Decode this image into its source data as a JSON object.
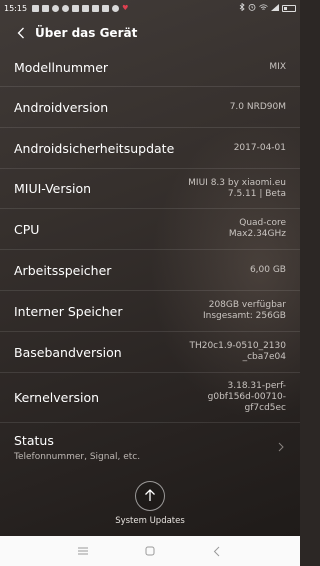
{
  "status_bar": {
    "time": "15:15",
    "battery_level": 0.25
  },
  "header": {
    "title": "Über das Gerät"
  },
  "rows": [
    {
      "label": "Modellnummer",
      "value": "MIX"
    },
    {
      "label": "Androidversion",
      "value": "7.0 NRD90M"
    },
    {
      "label": "Androidsicherheitsupdate",
      "value": "2017-04-01"
    },
    {
      "label": "MIUI-Version",
      "value": "MIUI 8.3 by xiaomi.eu\n7.5.11 | Beta"
    },
    {
      "label": "CPU",
      "value": "Quad-core\nMax2.34GHz"
    },
    {
      "label": "Arbeitsspeicher",
      "value": "6,00 GB"
    },
    {
      "label": "Interner Speicher",
      "value": "208GB verfügbar\nInsgesamt: 256GB"
    },
    {
      "label": "Basebandversion",
      "value": "TH20c1.9-0510_2130\n_cba7e04"
    },
    {
      "label": "Kernelversion",
      "value": "3.18.31-perf-\ng0bf156d-00710-\ngf7cd5ec"
    }
  ],
  "status_item": {
    "title": "Status",
    "subtitle": "Telefonnummer, Signal, etc."
  },
  "updates": {
    "label": "System Updates"
  },
  "colors": {
    "background": "#2c2725",
    "nav_bar": "#fafafa",
    "text": "#ffffff",
    "secondary_text": "#c9c4c0"
  }
}
